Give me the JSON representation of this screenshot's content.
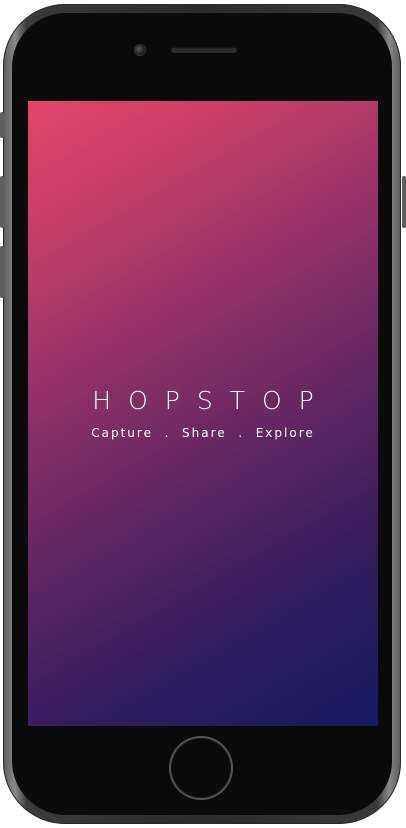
{
  "device": {
    "model": "iphone-frame",
    "frame_color": "#2c2c2c"
  },
  "screen": {
    "gradient_start": "#e2456a",
    "gradient_end": "#171963"
  },
  "splash": {
    "app_name": "HOPSTOP",
    "tagline": "Capture  .  Share  .  Explore",
    "text_color": "#ffffff"
  }
}
